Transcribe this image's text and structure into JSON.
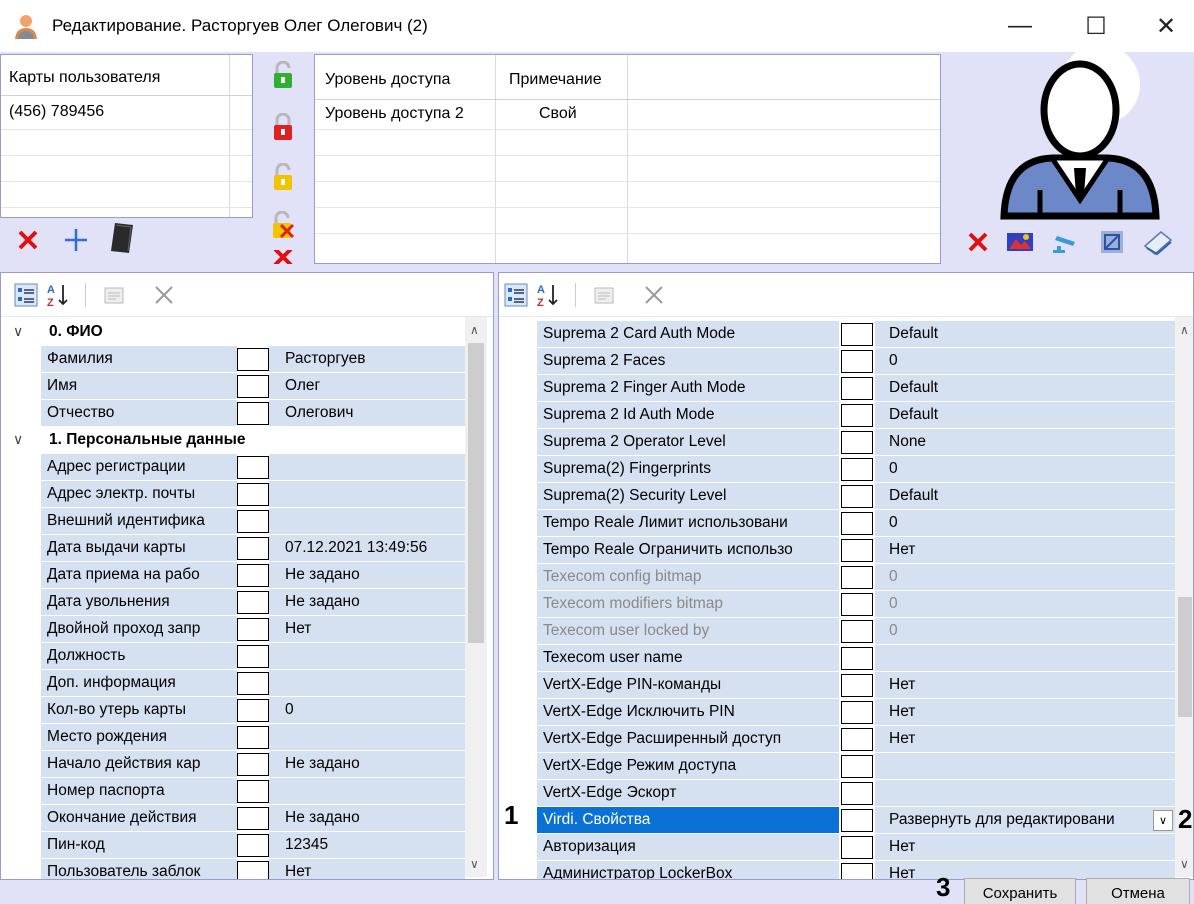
{
  "window": {
    "title": "Редактирование. Расторгуев Олег Олегович (2)",
    "minimize": "—",
    "maximize": "☐",
    "close": "✕"
  },
  "cards": {
    "header": "Карты пользователя",
    "items": [
      "(456) 789456"
    ]
  },
  "access": {
    "col_level": "Уровень доступа",
    "col_note": "Примечание",
    "rows": [
      {
        "level": "Уровень доступа 2",
        "note": "Свой"
      }
    ]
  },
  "left_grid": {
    "rows": [
      {
        "type": "cat",
        "name": "0. ФИО"
      },
      {
        "type": "prop",
        "name": "Фамилия",
        "value": "Расторгуев"
      },
      {
        "type": "prop",
        "name": "Имя",
        "value": "Олег"
      },
      {
        "type": "prop",
        "name": "Отчество",
        "value": "Олегович"
      },
      {
        "type": "cat",
        "name": "1. Персональные данные"
      },
      {
        "type": "prop",
        "name": "Адрес регистрации",
        "value": ""
      },
      {
        "type": "prop",
        "name": "Адрес электр. почты",
        "value": ""
      },
      {
        "type": "prop",
        "name": "Внешний идентифика",
        "value": ""
      },
      {
        "type": "prop",
        "name": "Дата выдачи карты",
        "value": "07.12.2021 13:49:56"
      },
      {
        "type": "prop",
        "name": "Дата приема на рабо",
        "value": "Не задано"
      },
      {
        "type": "prop",
        "name": "Дата увольнения",
        "value": "Не задано"
      },
      {
        "type": "prop",
        "name": "Двойной проход запр",
        "value": "Нет"
      },
      {
        "type": "prop",
        "name": "Должность",
        "value": ""
      },
      {
        "type": "prop",
        "name": "Доп. информация",
        "value": ""
      },
      {
        "type": "prop",
        "name": "Кол-во утерь карты",
        "value": "0"
      },
      {
        "type": "prop",
        "name": "Место рождения",
        "value": ""
      },
      {
        "type": "prop",
        "name": "Начало действия кар",
        "value": "Не задано"
      },
      {
        "type": "prop",
        "name": "Номер паспорта",
        "value": ""
      },
      {
        "type": "prop",
        "name": "Окончание действия",
        "value": "Не задано"
      },
      {
        "type": "prop",
        "name": "Пин-код",
        "value": "12345"
      },
      {
        "type": "prop",
        "name": "Пользователь заблок",
        "value": "Нет"
      }
    ]
  },
  "right_grid": {
    "rows": [
      {
        "name": "Suprema 2 Card Auth Mode",
        "value": "Default"
      },
      {
        "name": "Suprema 2 Faces",
        "value": "0"
      },
      {
        "name": "Suprema 2 Finger Auth Mode",
        "value": "Default"
      },
      {
        "name": "Suprema 2 Id Auth Mode",
        "value": "Default"
      },
      {
        "name": "Suprema 2 Operator Level",
        "value": "None"
      },
      {
        "name": "Suprema(2) Fingerprints",
        "value": "0"
      },
      {
        "name": "Suprema(2) Security Level",
        "value": "Default"
      },
      {
        "name": "Tempo Reale Лимит использовани",
        "value": "0"
      },
      {
        "name": "Tempo Reale Ограничить использо",
        "value": "Нет"
      },
      {
        "name": "Texecom config bitmap",
        "value": "0",
        "disabled": true
      },
      {
        "name": "Texecom modifiers bitmap",
        "value": "0",
        "disabled": true
      },
      {
        "name": "Texecom user locked by",
        "value": "0",
        "disabled": true
      },
      {
        "name": "Texecom user name",
        "value": ""
      },
      {
        "name": "VertX-Edge PIN-команды",
        "value": "Нет"
      },
      {
        "name": "VertX-Edge Исключить PIN",
        "value": "Нет"
      },
      {
        "name": "VertX-Edge Расширенный доступ",
        "value": "Нет"
      },
      {
        "name": "VertX-Edge Режим доступа",
        "value": ""
      },
      {
        "name": "VertX-Edge Эскорт",
        "value": ""
      },
      {
        "name": "Virdi. Свойства",
        "value": "Развернуть для редактировани",
        "selected": true,
        "dropdown": true
      },
      {
        "name": "Авторизация",
        "value": "Нет"
      },
      {
        "name": "Администратор LockerBox",
        "value": "Нет"
      }
    ]
  },
  "markers": {
    "m1": "1",
    "m2": "2",
    "m3": "3"
  },
  "buttons": {
    "save": "Сохранить",
    "cancel": "Отмена"
  }
}
